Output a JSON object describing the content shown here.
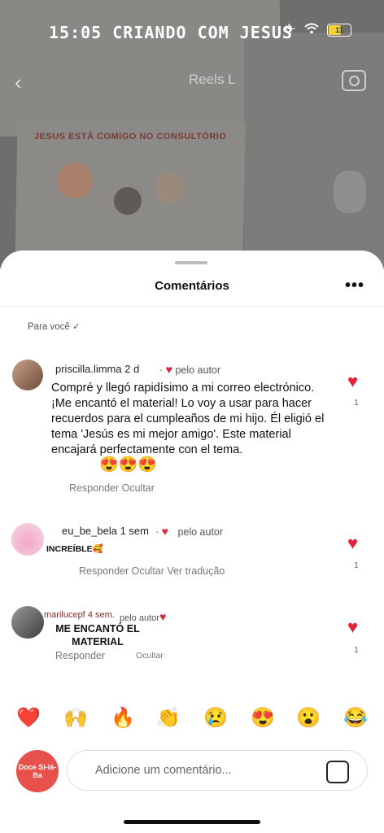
{
  "status_bar": {
    "time": "15:05 CRIANDO COM JESUS",
    "battery_level": "11"
  },
  "top_nav": {
    "title": "Reels L"
  },
  "background_art": {
    "title": "JESUS ESTÁ COMIGO NO CONSULTÓRIO"
  },
  "sheet": {
    "title": "Comentários",
    "filter_label": "Para você ✓"
  },
  "comments": [
    {
      "username": "priscilla.limma",
      "time": "2 d",
      "author_tag": "pelo autor",
      "text_lines": [
        "Compré y llegó rapidísimo a mi correo electrónico.",
        "¡Me encantó el material! Lo voy a usar para hacer",
        "recuerdos para el cumpleaños de mi hijo. Él eligió el",
        "tema 'Jesús es mi mejor amigo'. Este material",
        "encajará perfectamente con el tema."
      ],
      "emojis": "😍😍😍",
      "actions": "Responder Ocultar",
      "likes": "1"
    },
    {
      "username": "eu_be_bela",
      "time": "1 sem",
      "author_tag": "pelo autor",
      "text": "INCREÍBLE🥰",
      "actions": "Responder Ocultar Ver tradução",
      "likes": "1"
    },
    {
      "username": "marilucepf",
      "time": "4 sem.",
      "author_tag": "pelo autor",
      "text_lines": [
        "ME ENCANTÓ EL",
        "MATERIAL"
      ],
      "action_reply": "Responder",
      "action_hide": "Ocultar",
      "likes": "1"
    }
  ],
  "reactions": [
    "❤️",
    "🙌",
    "🔥",
    "👏",
    "😢",
    "😍",
    "😮",
    "😂"
  ],
  "composer": {
    "avatar_text": "Doce Si-lá-Ba",
    "placeholder": "Adicione um comentário..."
  },
  "colors": {
    "heart": "#e0243b",
    "avatar_bg": "#e8504c"
  }
}
